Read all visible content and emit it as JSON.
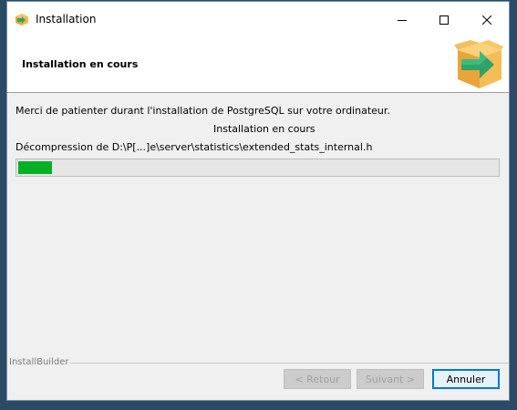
{
  "window": {
    "title": "Installation"
  },
  "header": {
    "title": "Installation en cours"
  },
  "body": {
    "message": "Merci de patienter durant l'installation de PostgreSQL sur votre ordinateur.",
    "status": "Installation en cours",
    "detail": "Décompression de D:\\P[...]e\\server\\statistics\\extended_stats_internal.h"
  },
  "progress": {
    "fraction": 0.07,
    "color": "#06b025"
  },
  "footer": {
    "brand": "InstallBuilder"
  },
  "buttons": {
    "back": "< Retour",
    "next": "Suivant >",
    "cancel": "Annuler"
  }
}
